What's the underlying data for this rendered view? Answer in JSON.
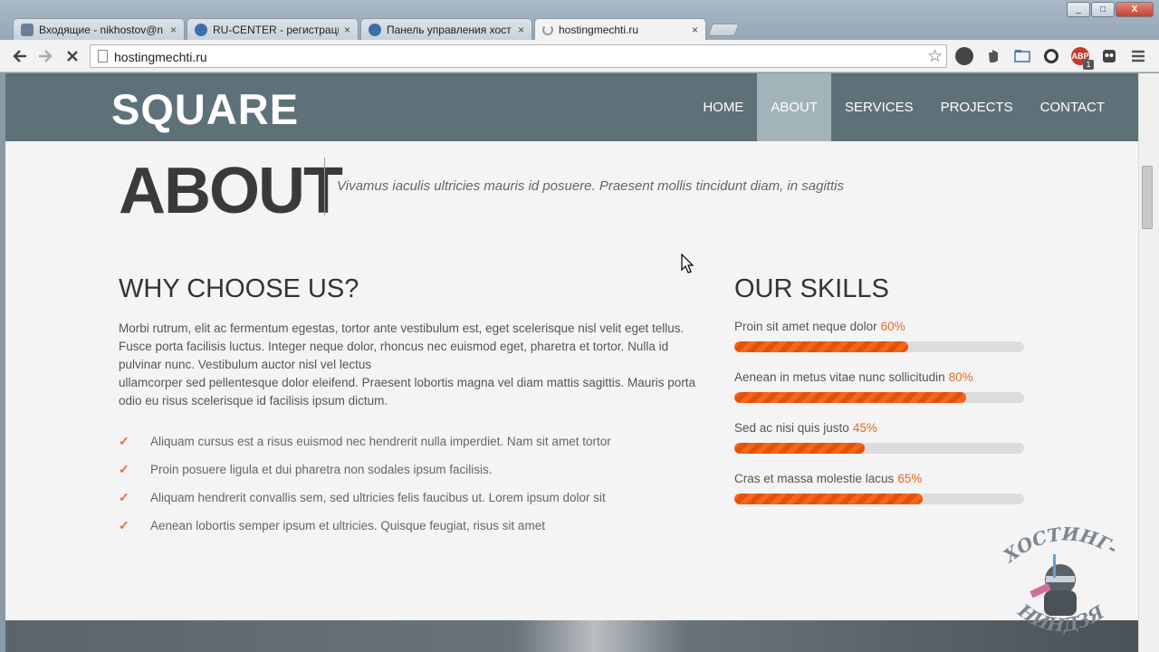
{
  "browser": {
    "tabs": [
      {
        "title": "Входящие - nikhostov@n",
        "favicon_color": "#6b7f94"
      },
      {
        "title": "RU-CENTER - регистраци",
        "favicon_color": "#3f6ea8"
      },
      {
        "title": "Панель управления хост",
        "favicon_color": "#3f6ea8"
      },
      {
        "title": "hostingmechti.ru",
        "favicon_color": "#888888",
        "active": true
      }
    ],
    "tab_close": "×",
    "window_buttons": {
      "minimize": "_",
      "maximize": "□",
      "close": "X"
    },
    "address": "hostingmechti.ru",
    "extensions": [
      {
        "name": "clock-icon",
        "label": "",
        "color": "#444444"
      },
      {
        "name": "evernote-icon",
        "label": "",
        "color": "#555555"
      },
      {
        "name": "folder-icon",
        "label": "",
        "color": "#4a78b5"
      },
      {
        "name": "circle-icon",
        "label": "",
        "color": "#333333"
      },
      {
        "name": "adblock-icon",
        "label": "ABP",
        "color": "#c33b2e"
      },
      {
        "name": "mask-icon",
        "label": "",
        "color": "#444444"
      }
    ],
    "adblock_badge": "1"
  },
  "site": {
    "logo": "SQUARE",
    "menu": [
      "HOME",
      "ABOUT",
      "SERVICES",
      "PROJECTS",
      "CONTACT"
    ],
    "active_menu": "ABOUT",
    "page_title": "ABOUT",
    "page_subtitle": "Vivamus iaculis ultricies mauris id posuere. Praesent mollis tincidunt diam, in sagittis",
    "why": {
      "heading": "WHY CHOOSE US?",
      "paragraph_1": "Morbi rutrum, elit ac fermentum egestas, tortor ante vestibulum est, eget scelerisque nisl velit eget tellus. Fusce porta facilisis luctus. Integer neque dolor, rhoncus nec euismod eget, pharetra et tortor. Nulla id pulvinar nunc. Vestibulum auctor nisl vel lectus",
      "paragraph_2": "ullamcorper sed pellentesque dolor eleifend. Praesent lobortis magna vel diam mattis sagittis. Mauris porta odio eu risus scelerisque id facilisis ipsum dictum.",
      "checklist": [
        "Aliquam cursus est a risus euismod nec hendrerit nulla imperdiet. Nam sit amet tortor",
        "Proin posuere ligula et dui pharetra non sodales ipsum facilisis.",
        "Aliquam hendrerit convallis sem, sed ultricies felis faucibus ut. Lorem ipsum dolor sit",
        "Aenean lobortis semper ipsum et ultricies. Quisque feugiat, risus sit amet"
      ]
    },
    "skills": {
      "heading": "OUR SKILLS",
      "items": [
        {
          "label": "Proin sit amet neque dolor",
          "pct_text": "60%",
          "value": 60
        },
        {
          "label": "Aenean in metus vitae nunc sollicitudin",
          "pct_text": "80%",
          "value": 80
        },
        {
          "label": "Sed ac nisi quis justo",
          "pct_text": "45%",
          "value": 45
        },
        {
          "label": "Cras et massa molestie lacus",
          "pct_text": "65%",
          "value": 65
        }
      ]
    }
  },
  "watermark": {
    "line1": "ХОСТИНГ-",
    "line2": "НИНДЗЯ"
  },
  "colors": {
    "header": "#5f7178",
    "active_menu": "#a2b3b9",
    "accent": "#ea6d2b"
  }
}
